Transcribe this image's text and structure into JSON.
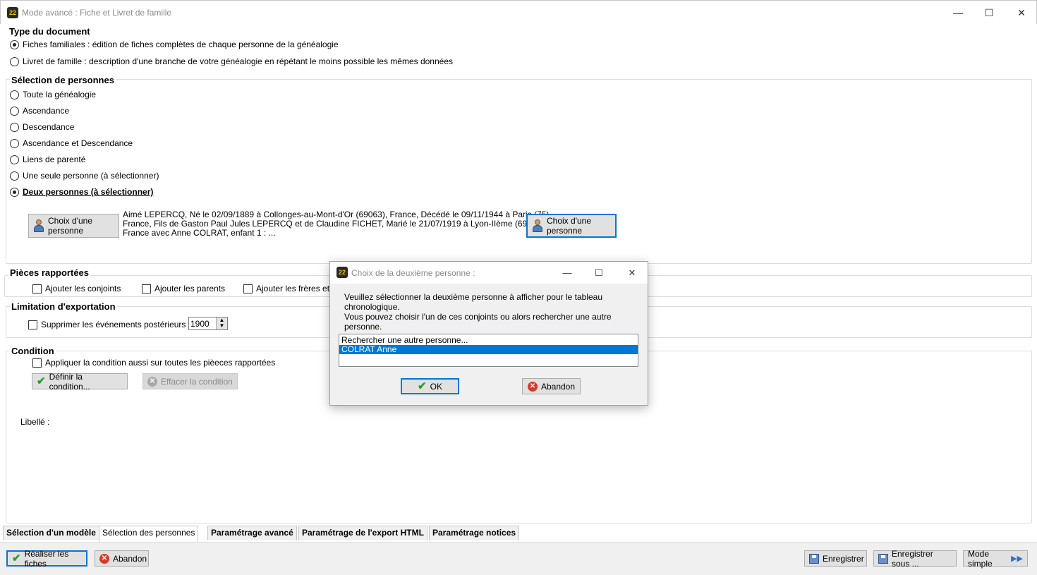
{
  "window": {
    "app_icon": "22",
    "title": "Mode avancé : Fiche et Livret de famille",
    "minimize": "—",
    "maximize": "☐",
    "close": "✕"
  },
  "type_document": {
    "title": "Type du document",
    "options": [
      {
        "label": "Fiches familiales : édition de fiches complètes de chaque personne de la généalogie",
        "selected": true
      },
      {
        "label": "Livret de famille : description d'une branche de votre généalogie en répétant le moins possible les mêmes données",
        "selected": false
      }
    ]
  },
  "selection": {
    "title": "Sélection de personnes",
    "options": [
      {
        "label": "Toute la généalogie",
        "selected": false
      },
      {
        "label": "Ascendance",
        "selected": false
      },
      {
        "label": "Descendance",
        "selected": false
      },
      {
        "label": "Ascendance et Descendance",
        "selected": false
      },
      {
        "label": "Liens de parenté",
        "selected": false
      },
      {
        "label": "Une seule personne (à sélectionner)",
        "selected": false
      },
      {
        "label": "Deux personnes (à sélectionner)",
        "selected": true
      }
    ],
    "choose_button_1": "Choix d'une personne",
    "person_1_description": [
      "Aimé LEPERCQ, Né le 02/09/1889 à Collonges-au-Mont-d'Or (69063), France, Décédé le 09/11/1944 à Paris (75),",
      "France, Fils de Gaston Paul Jules LEPERCQ et de Claudine FICHET, Marié le 21/07/1919 à Lyon-IIème (69382),",
      "France avec Anne COLRAT, enfant 1 : ..."
    ],
    "choose_button_2": "Choix d'une personne"
  },
  "pieces": {
    "title": "Pièces rapportées",
    "checks": [
      "Ajouter les conjoints",
      "Ajouter les parents",
      "Ajouter les frères et soe"
    ]
  },
  "limitation": {
    "title": "Limitation d'exportation",
    "check_label": "Supprimer les événements postérieurs à :",
    "year_value": "1900"
  },
  "condition": {
    "title": "Condition",
    "check_label": "Appliquer la condition aussi sur toutes les pièeces rapportées",
    "define_button": "Définir la condition...",
    "clear_button": "Effacer la condition",
    "libelle_label": "Libellé :"
  },
  "tabs": [
    "Sélection d'un modèle",
    "Sélection des personnes",
    "Paramétrage avancé",
    "Paramétrage de l'export HTML",
    "Paramétrage notices"
  ],
  "active_tab": 1,
  "bottom": {
    "run_button": "Réaliser les fiches",
    "cancel_button": "Abandon",
    "save_button": "Enregistrer",
    "save_as_button": "Enregistrer sous ...",
    "simple_mode_button": "Mode simple"
  },
  "dialog": {
    "title": "Choix de la deuxième personne :",
    "message_line1": "Veuillez sélectionner la deuxième personne à afficher pour le tableau chronologique.",
    "message_line2": "Vous pouvez choisir l'un de ces conjoints ou alors rechercher une autre personne.",
    "list_items": [
      "Rechercher une autre personne...",
      "COLRAT Anne"
    ],
    "selected_index": 1,
    "ok_button": "OK",
    "cancel_button": "Abandon"
  },
  "colors": {
    "accent": "#0078d7",
    "ok_green": "#2e9a2e",
    "cancel_red": "#d63a2e",
    "icon_yellow": "#f2c200"
  }
}
